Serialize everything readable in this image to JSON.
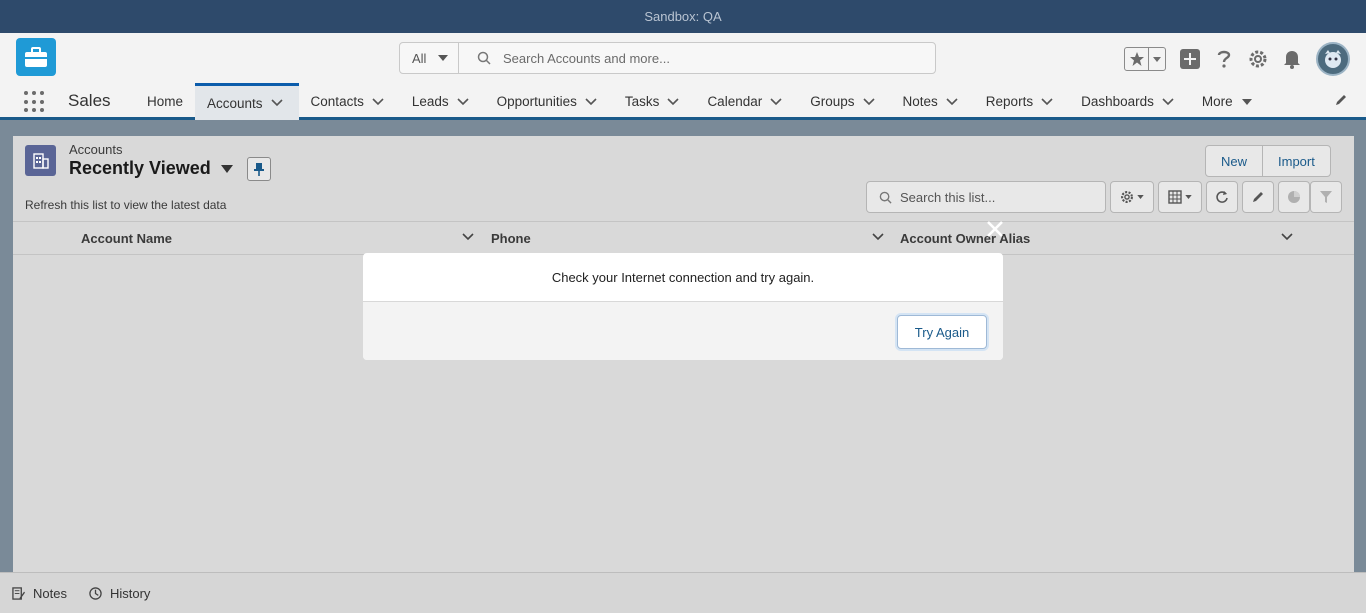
{
  "sandbox": {
    "label": "Sandbox: QA"
  },
  "header": {
    "search_scope": "All",
    "search_placeholder": "Search Accounts and more..."
  },
  "nav": {
    "app_name": "Sales",
    "items": [
      {
        "label": "Home",
        "has_menu": false
      },
      {
        "label": "Accounts",
        "has_menu": true,
        "active": true
      },
      {
        "label": "Contacts",
        "has_menu": true
      },
      {
        "label": "Leads",
        "has_menu": true
      },
      {
        "label": "Opportunities",
        "has_menu": true
      },
      {
        "label": "Tasks",
        "has_menu": true
      },
      {
        "label": "Calendar",
        "has_menu": true
      },
      {
        "label": "Groups",
        "has_menu": true
      },
      {
        "label": "Notes",
        "has_menu": true
      },
      {
        "label": "Reports",
        "has_menu": true
      },
      {
        "label": "Dashboards",
        "has_menu": true
      },
      {
        "label": "More",
        "has_menu": true
      }
    ]
  },
  "list": {
    "object_label": "Accounts",
    "view_name": "Recently Viewed",
    "refresh_note": "Refresh this list to view the latest data",
    "new_label": "New",
    "import_label": "Import",
    "search_placeholder": "Search this list...",
    "columns": [
      "Account Name",
      "Phone",
      "Account Owner Alias"
    ]
  },
  "modal": {
    "message": "Check your Internet connection and try again.",
    "try_again_label": "Try Again"
  },
  "utility": {
    "notes_label": "Notes",
    "history_label": "History"
  },
  "colors": {
    "brand": "#0b5cab",
    "sandbox_bar": "#2e4a6b"
  }
}
